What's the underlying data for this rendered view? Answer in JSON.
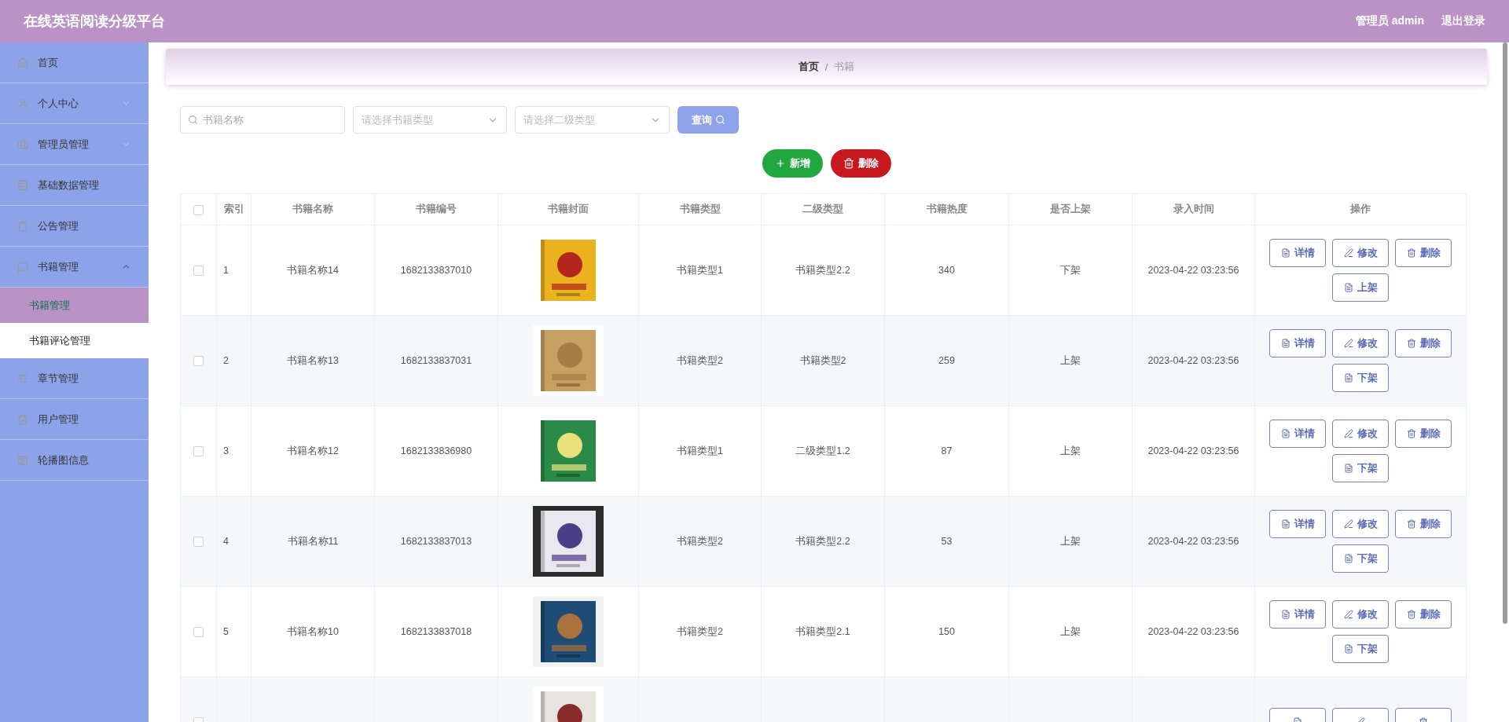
{
  "header": {
    "title": "在线英语阅读分级平台",
    "user": "管理员 admin",
    "logout": "退出登录"
  },
  "sidebar": {
    "items": [
      {
        "label": "首页",
        "selected": false
      },
      {
        "label": "个人中心",
        "selected": false,
        "expanded": false
      },
      {
        "label": "管理员管理",
        "selected": false,
        "expanded": false
      },
      {
        "label": "基础数据管理",
        "selected": false
      },
      {
        "label": "公告管理",
        "selected": false
      },
      {
        "label": "书籍管理",
        "selected": false,
        "expanded": true,
        "children": [
          {
            "label": "书籍管理",
            "selected": true
          },
          {
            "label": "书籍评论管理",
            "selected": false
          }
        ]
      },
      {
        "label": "章节管理",
        "selected": false
      },
      {
        "label": "用户管理",
        "selected": false
      },
      {
        "label": "轮播图信息",
        "selected": false
      }
    ]
  },
  "breadcrumb": {
    "items": [
      "首页",
      "书籍"
    ],
    "separator": "/"
  },
  "filters": {
    "name": {
      "placeholder": "书籍名称"
    },
    "type": {
      "placeholder": "请选择书籍类型"
    },
    "subtype": {
      "placeholder": "请选择二级类型"
    },
    "query": "查询"
  },
  "actions": {
    "add": "新增",
    "delete": "删除"
  },
  "table": {
    "all_checked": false,
    "columns": [
      "索引",
      "书籍名称",
      "书籍编号",
      "书籍封面",
      "书籍类型",
      "二级类型",
      "书籍热度",
      "是否上架",
      "录入时间",
      "操作"
    ],
    "rows": [
      {
        "checked": false,
        "cells": [
          "1",
          "书籍名称14",
          "1682133837010",
          "",
          "书籍类型1",
          "书籍类型2.2",
          "340",
          "下架",
          "2023-04-22 03:23:56"
        ],
        "ops": [
          {
            "kind": "detail",
            "label": "详情"
          },
          {
            "kind": "edit",
            "label": "修改"
          },
          {
            "kind": "delete",
            "label": "删除"
          },
          {
            "kind": "shelf",
            "label": "上架"
          }
        ]
      },
      {
        "checked": false,
        "cells": [
          "2",
          "书籍名称13",
          "1682133837031",
          "",
          "书籍类型2",
          "书籍类型2",
          "259",
          "上架",
          "2023-04-22 03:23:56"
        ],
        "ops": [
          {
            "kind": "detail",
            "label": "详情"
          },
          {
            "kind": "edit",
            "label": "修改"
          },
          {
            "kind": "delete",
            "label": "删除"
          },
          {
            "kind": "shelf",
            "label": "下架"
          }
        ]
      },
      {
        "checked": false,
        "cells": [
          "3",
          "书籍名称12",
          "1682133836980",
          "",
          "书籍类型1",
          "二级类型1.2",
          "87",
          "上架",
          "2023-04-22 03:23:56"
        ],
        "ops": [
          {
            "kind": "detail",
            "label": "详情"
          },
          {
            "kind": "edit",
            "label": "修改"
          },
          {
            "kind": "delete",
            "label": "删除"
          },
          {
            "kind": "shelf",
            "label": "下架"
          }
        ]
      },
      {
        "checked": false,
        "cells": [
          "4",
          "书籍名称11",
          "1682133837013",
          "",
          "书籍类型2",
          "书籍类型2.2",
          "53",
          "上架",
          "2023-04-22 03:23:56"
        ],
        "ops": [
          {
            "kind": "detail",
            "label": "详情"
          },
          {
            "kind": "edit",
            "label": "修改"
          },
          {
            "kind": "delete",
            "label": "删除"
          },
          {
            "kind": "shelf",
            "label": "下架"
          }
        ]
      },
      {
        "checked": false,
        "cells": [
          "5",
          "书籍名称10",
          "1682133837018",
          "",
          "书籍类型2",
          "书籍类型2.1",
          "150",
          "上架",
          "2023-04-22 03:23:56"
        ],
        "ops": [
          {
            "kind": "detail",
            "label": "详情"
          },
          {
            "kind": "edit",
            "label": "修改"
          },
          {
            "kind": "delete",
            "label": "删除"
          },
          {
            "kind": "shelf",
            "label": "下架"
          }
        ]
      },
      {
        "checked": false,
        "cells": [
          "",
          "",
          "",
          "",
          "",
          "",
          "",
          "",
          ""
        ],
        "ops": [
          {
            "kind": "detail"
          },
          {
            "kind": "edit"
          },
          {
            "kind": "delete"
          }
        ]
      }
    ]
  }
}
